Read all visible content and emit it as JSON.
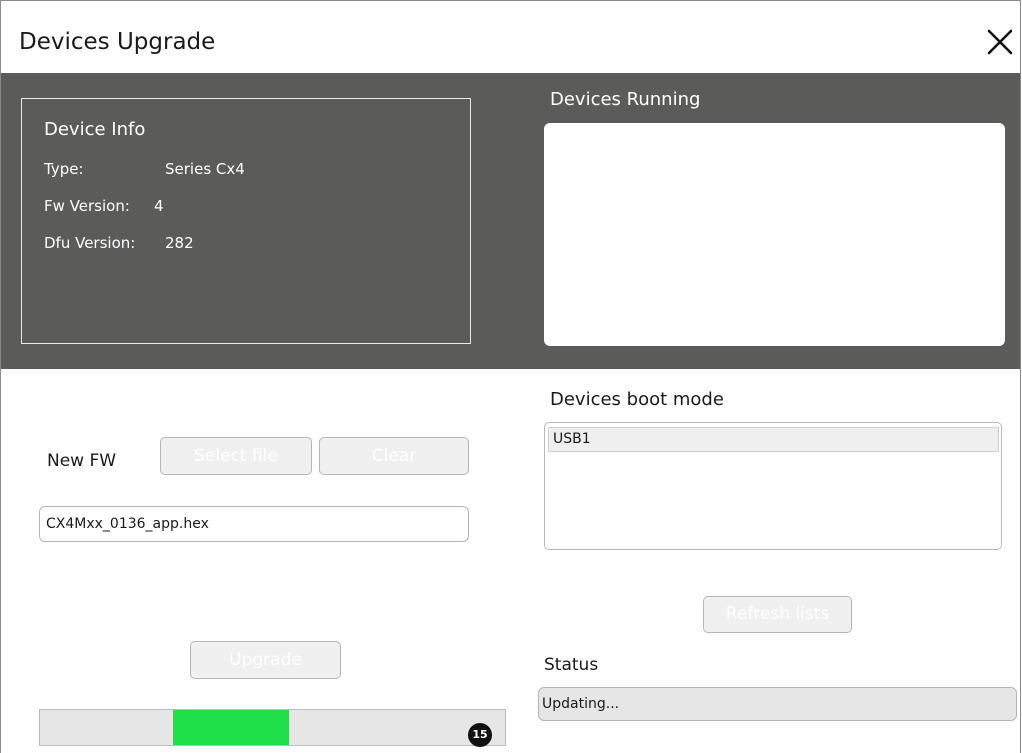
{
  "window": {
    "title": "Devices Upgrade",
    "close_icon": "close-icon"
  },
  "device_info": {
    "heading": "Device Info",
    "rows": [
      {
        "label": "Type:",
        "value": "Series Cx4"
      },
      {
        "label": "Fw Version:",
        "value": "4"
      },
      {
        "label": "Dfu Version:",
        "value": "282"
      }
    ]
  },
  "devices_running": {
    "heading": "Devices Running",
    "items": []
  },
  "devices_boot_mode": {
    "heading": "Devices boot mode",
    "items": [
      {
        "label": "USB1",
        "selected": true
      }
    ]
  },
  "new_fw": {
    "label": "New FW",
    "select_file_label": "Select file",
    "clear_label": "Clear",
    "file_value": "CX4Mxx_0136_app.hex"
  },
  "actions": {
    "upgrade_label": "Upgrade",
    "refresh_label": "Refresh lists"
  },
  "status": {
    "heading": "Status",
    "text": "Updating..."
  },
  "progress": {
    "fill_start_fraction": 0.287,
    "fill_end_fraction": 0.535,
    "badge": "15"
  },
  "colors": {
    "dark_band": "#5b5b5a",
    "progress_fill": "#1fe04b",
    "button_bg": "#f0f0f0"
  }
}
